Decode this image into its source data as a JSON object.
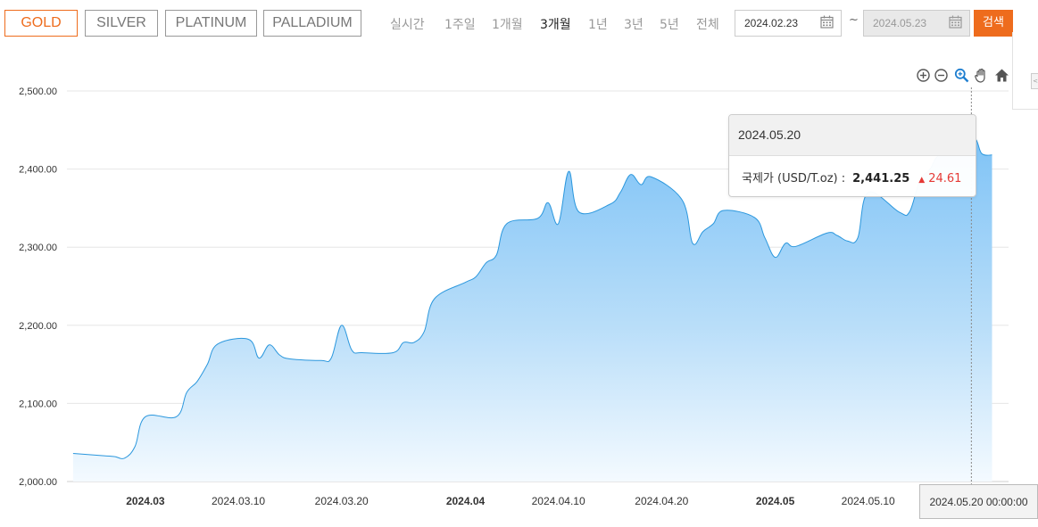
{
  "metal_tabs": [
    {
      "label": "GOLD",
      "active": true
    },
    {
      "label": "SILVER",
      "active": false
    },
    {
      "label": "PLATINUM",
      "active": false
    },
    {
      "label": "PALLADIUM",
      "active": false
    }
  ],
  "periods": [
    {
      "label": "실시간",
      "active": false
    },
    {
      "label": "1주일",
      "active": false
    },
    {
      "label": "1개월",
      "active": false
    },
    {
      "label": "3개월",
      "active": true
    },
    {
      "label": "1년",
      "active": false
    },
    {
      "label": "3년",
      "active": false
    },
    {
      "label": "5년",
      "active": false
    },
    {
      "label": "전체",
      "active": false
    }
  ],
  "date_range": {
    "start": "2024.02.23",
    "separator": "~",
    "end": "2024.05.23"
  },
  "search_label": "검색",
  "toolbar_icons": [
    "zoom-in-icon",
    "zoom-out-icon",
    "zoom-search-icon",
    "pan-hand-icon",
    "home-icon"
  ],
  "tooltip": {
    "date": "2024.05.20",
    "label": "국제가 (USD/T.oz) :",
    "price": "2,441.25",
    "arrow": "▲",
    "change": "24.61"
  },
  "crosshair_label": "2024.05.20 00:00:00",
  "colors": {
    "accent": "#ee6c1d",
    "series_line": "#2b97dd",
    "area_top": "#85c6f7",
    "up": "#e53935"
  },
  "chart_data": {
    "type": "area",
    "title": "",
    "xlabel": "",
    "ylabel": "",
    "ylim": [
      2000,
      2500
    ],
    "y_ticks": [
      "2,500.00",
      "2,400.00",
      "2,300.00",
      "2,200.00",
      "2,100.00",
      "2,000.00"
    ],
    "x_ticks": [
      {
        "label": "2024.03",
        "bold": true
      },
      {
        "label": "2024.03.10",
        "bold": false
      },
      {
        "label": "2024.03.20",
        "bold": false
      },
      {
        "label": "2024.04",
        "bold": true
      },
      {
        "label": "2024.04.10",
        "bold": false
      },
      {
        "label": "2024.04.20",
        "bold": false
      },
      {
        "label": "2024.05",
        "bold": true
      },
      {
        "label": "2024.05.10",
        "bold": false
      }
    ],
    "grid": true,
    "legend": "none",
    "series": [
      {
        "points": [
          [
            "2024-02-23",
            2036
          ],
          [
            "2024-02-26",
            2033
          ],
          [
            "2024-02-27",
            2032
          ],
          [
            "2024-02-28",
            2030
          ],
          [
            "2024-02-29",
            2045
          ],
          [
            "2024-03-01",
            2083
          ],
          [
            "2024-03-04",
            2083
          ],
          [
            "2024-03-05",
            2114
          ],
          [
            "2024-03-06",
            2128
          ],
          [
            "2024-03-07",
            2150
          ],
          [
            "2024-03-08",
            2176
          ],
          [
            "2024-03-11",
            2182
          ],
          [
            "2024-03-12",
            2158
          ],
          [
            "2024-03-13",
            2175
          ],
          [
            "2024-03-14",
            2162
          ],
          [
            "2024-03-15",
            2157
          ],
          [
            "2024-03-18",
            2155
          ],
          [
            "2024-03-19",
            2158
          ],
          [
            "2024-03-20",
            2200
          ],
          [
            "2024-03-21",
            2168
          ],
          [
            "2024-03-22",
            2165
          ],
          [
            "2024-03-25",
            2165
          ],
          [
            "2024-03-26",
            2178
          ],
          [
            "2024-03-27",
            2178
          ],
          [
            "2024-03-28",
            2192
          ],
          [
            "2024-03-29",
            2234
          ],
          [
            "2024-04-01",
            2255
          ],
          [
            "2024-04-02",
            2262
          ],
          [
            "2024-04-03",
            2280
          ],
          [
            "2024-04-04",
            2290
          ],
          [
            "2024-04-05",
            2330
          ],
          [
            "2024-04-08",
            2337
          ],
          [
            "2024-04-09",
            2357
          ],
          [
            "2024-04-10",
            2330
          ],
          [
            "2024-04-11",
            2397
          ],
          [
            "2024-04-12",
            2345
          ],
          [
            "2024-04-15",
            2355
          ],
          [
            "2024-04-16",
            2370
          ],
          [
            "2024-04-17",
            2393
          ],
          [
            "2024-04-18",
            2380
          ],
          [
            "2024-04-19",
            2390
          ],
          [
            "2024-04-22",
            2360
          ],
          [
            "2024-04-23",
            2305
          ],
          [
            "2024-04-24",
            2320
          ],
          [
            "2024-04-25",
            2330
          ],
          [
            "2024-04-26",
            2347
          ],
          [
            "2024-04-29",
            2338
          ],
          [
            "2024-04-30",
            2312
          ],
          [
            "2024-05-01",
            2287
          ],
          [
            "2024-05-02",
            2305
          ],
          [
            "2024-05-03",
            2301
          ],
          [
            "2024-05-06",
            2318
          ],
          [
            "2024-05-07",
            2315
          ],
          [
            "2024-05-08",
            2308
          ],
          [
            "2024-05-09",
            2312
          ],
          [
            "2024-05-10",
            2370
          ],
          [
            "2024-05-13",
            2345
          ],
          [
            "2024-05-14",
            2345
          ],
          [
            "2024-05-15",
            2385
          ],
          [
            "2024-05-16",
            2400
          ],
          [
            "2024-05-17",
            2420
          ],
          [
            "2024-05-20",
            2441.25
          ],
          [
            "2024-05-21",
            2420
          ],
          [
            "2024-05-22",
            2418
          ]
        ]
      }
    ]
  }
}
